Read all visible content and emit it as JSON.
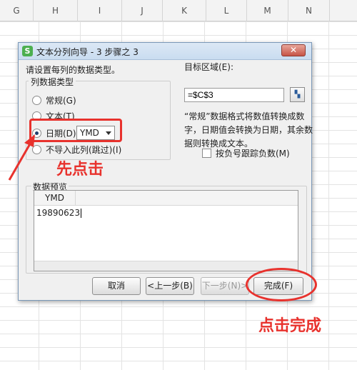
{
  "sheet": {
    "columns": [
      "G",
      "H",
      "I",
      "J",
      "K",
      "L",
      "M",
      "N"
    ]
  },
  "dialog": {
    "title": "文本分列向导 - 3 步骤之 3",
    "close_label": "✕",
    "instruction": "请设置每列的数据类型。",
    "column_type_group": "列数据类型",
    "radio_options": [
      {
        "label": "常规(G)",
        "selected": false
      },
      {
        "label": "文本(T)",
        "selected": false
      },
      {
        "label": "日期(D)",
        "selected": true
      },
      {
        "label": "不导入此列(跳过)(I)",
        "selected": false
      }
    ],
    "date_format": "YMD",
    "destination_label": "目标区域(E):",
    "destination_value": "=$C$3",
    "description": "“常规”数据格式将数值转换成数字，日期值会转换为日期，其余数据则转换成文本。",
    "negative_label": "按负号跟踪负数(M)",
    "preview_label": "数据预览",
    "preview_header": "YMD",
    "preview_value": "19890623",
    "buttons": {
      "cancel": "取消",
      "back": "<上一步(B)",
      "next": "下一步(N)>",
      "finish": "完成(F)"
    }
  },
  "annotations": {
    "click_first": "先点击",
    "click_finish": "点击完成",
    "accent_color": "#e8322d"
  }
}
